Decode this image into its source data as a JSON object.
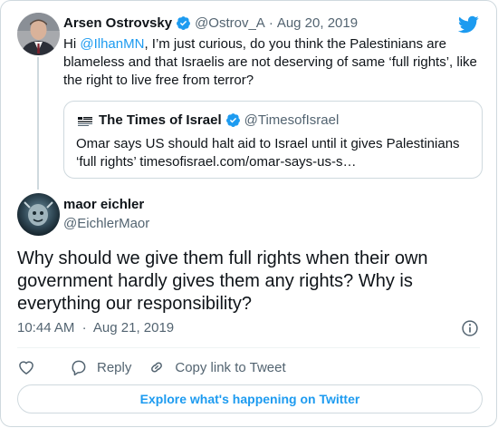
{
  "parent_tweet": {
    "author_name": "Arsen Ostrovsky",
    "author_handle": "@Ostrov_A",
    "separator": "·",
    "date": "Aug 20, 2019",
    "text_prefix": "Hi ",
    "mention": "@IlhanMN",
    "text_rest": ", I’m just curious, do you think the Palestinians are blameless and that Israelis are not deserving of same ‘full rights’, like the right to live free from terror?",
    "quoted_tweet": {
      "logo_text": "THE TIMES OF ISRAEL",
      "author_name": "The Times of Israel",
      "author_handle": "@TimesofIsrael",
      "text": "Omar says US should halt aid to Israel until it gives Palestinians ‘full rights’ timesofisrael.com/omar-says-us-s…"
    }
  },
  "main_tweet": {
    "author_name": "maor eichler",
    "author_handle": "@EichlerMaor",
    "text": "Why should we give them full rights when their own government hardly gives them any rights? Why is everything our responsibility?",
    "time": "10:44 AM",
    "separator": "·",
    "date": "Aug 21, 2019"
  },
  "actions": {
    "reply_label": "Reply",
    "copy_link_label": "Copy link to Tweet"
  },
  "explore_label": "Explore what's happening on Twitter",
  "icons": {
    "brand": "twitter-bird-icon",
    "verified": "verified-badge-icon",
    "info": "info-icon",
    "like": "heart-icon",
    "reply": "reply-bubble-icon",
    "copy_link": "link-icon"
  },
  "colors": {
    "accent": "#1d9bf0",
    "text": "#0f1419",
    "muted": "#536471",
    "border": "#cfd9de"
  }
}
